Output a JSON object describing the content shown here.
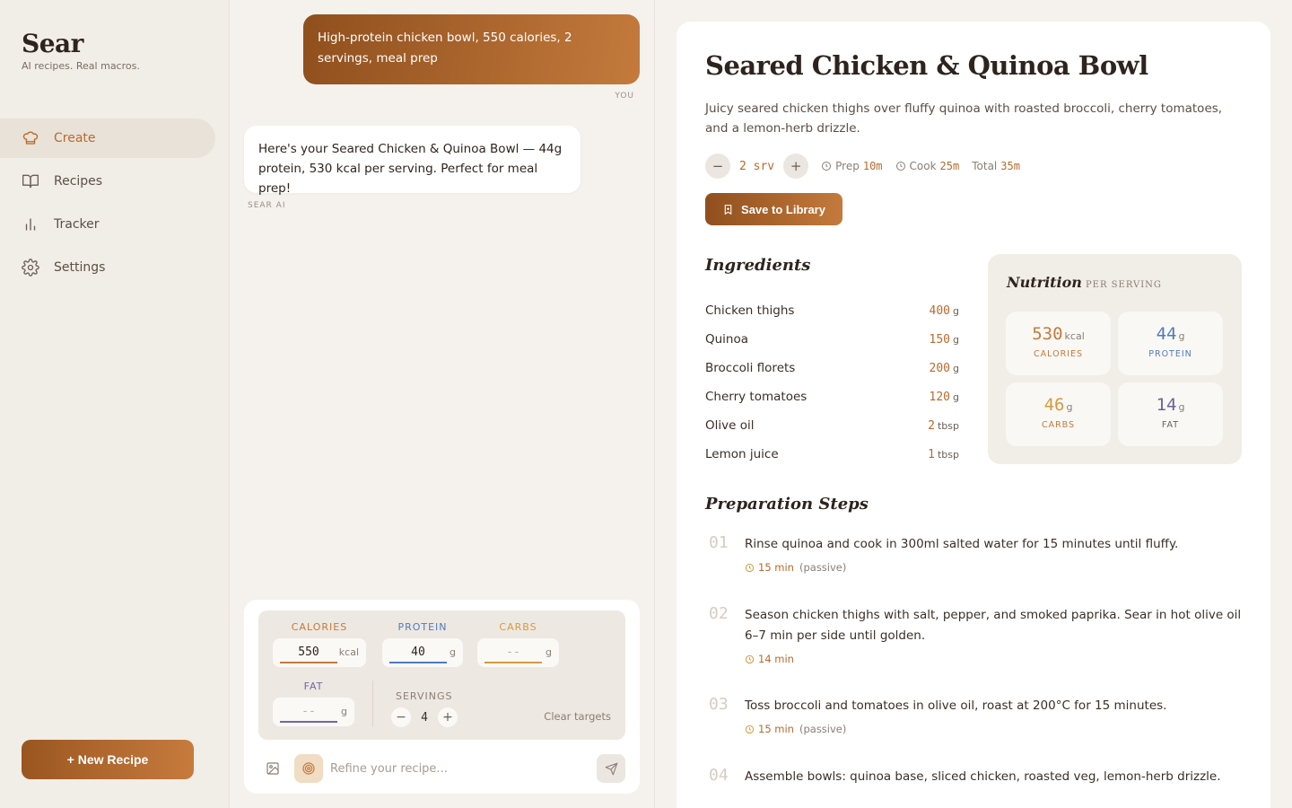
{
  "brand": {
    "name": "Sear",
    "tagline": "AI recipes. Real macros."
  },
  "nav": [
    {
      "label": "Create",
      "icon": "chef-hat-icon",
      "active": true
    },
    {
      "label": "Recipes",
      "icon": "book-icon",
      "active": false
    },
    {
      "label": "Tracker",
      "icon": "bar-chart-icon",
      "active": false
    },
    {
      "label": "Settings",
      "icon": "gear-icon",
      "active": false
    }
  ],
  "new_recipe_label": "+ New Recipe",
  "chat": {
    "user_message": "High-protein chicken bowl, 550 calories, 2 servings, meal prep",
    "user_label": "YOU",
    "ai_message": "Here's your Seared Chicken & Quinoa Bowl — 44g protein, 530 kcal per serving. Perfect for meal prep!",
    "ai_label": "SEAR AI"
  },
  "targets": {
    "calories": {
      "label": "CALORIES",
      "value": "550",
      "unit": "kcal",
      "color": "#c47a3c"
    },
    "protein": {
      "label": "PROTEIN",
      "value": "40",
      "unit": "g",
      "color": "#4f7bbf"
    },
    "carbs": {
      "label": "CARBS",
      "value": "--",
      "unit": "g",
      "color": "#d79a3e"
    },
    "fat": {
      "label": "FAT",
      "value": "--",
      "unit": "g",
      "color": "#7266a8"
    },
    "servings_label": "SERVINGS",
    "servings_value": "4",
    "clear_label": "Clear targets"
  },
  "composer": {
    "placeholder": "Refine your recipe..."
  },
  "recipe": {
    "title": "Seared Chicken & Quinoa Bowl",
    "description": "Juicy seared chicken thighs over fluffy quinoa with roasted broccoli, cherry tomatoes, and a lemon-herb drizzle.",
    "servings": "2 srv",
    "prep_label": "Prep",
    "prep_value": "10m",
    "cook_label": "Cook",
    "cook_value": "25m",
    "total_label": "Total",
    "total_value": "35m",
    "save_label": "Save to Library",
    "ingredients_heading": "Ingredients",
    "ingredients": [
      {
        "name": "Chicken thighs",
        "qty": "400",
        "unit": "g"
      },
      {
        "name": "Quinoa",
        "qty": "150",
        "unit": "g"
      },
      {
        "name": "Broccoli florets",
        "qty": "200",
        "unit": "g"
      },
      {
        "name": "Cherry tomatoes",
        "qty": "120",
        "unit": "g"
      },
      {
        "name": "Olive oil",
        "qty": "2",
        "unit": "tbsp"
      },
      {
        "name": "Lemon juice",
        "qty": "1",
        "unit": "tbsp"
      }
    ],
    "nutrition": {
      "heading": "Nutrition",
      "sub": "PER SERVING",
      "calories": {
        "value": "530",
        "unit": "kcal",
        "label": "CALORIES",
        "color": "#c47a3c"
      },
      "protein": {
        "value": "44",
        "unit": "g",
        "label": "PROTEIN",
        "color": "#4f7bbf"
      },
      "carbs": {
        "value": "46",
        "unit": "g",
        "label": "CARBS",
        "color": "#d79a3e"
      },
      "fat": {
        "value": "14",
        "unit": "g",
        "label": "FAT",
        "color": "#6a6494"
      }
    },
    "steps_heading": "Preparation Steps",
    "steps": [
      {
        "num": "01",
        "text": "Rinse quinoa and cook in 300ml salted water for 15 minutes until fluffy.",
        "time": "15 min",
        "note": "(passive)"
      },
      {
        "num": "02",
        "text": "Season chicken thighs with salt, pepper, and smoked paprika. Sear in hot olive oil 6–7 min per side until golden.",
        "time": "14 min",
        "note": ""
      },
      {
        "num": "03",
        "text": "Toss broccoli and tomatoes in olive oil, roast at 200°C for 15 minutes.",
        "time": "15 min",
        "note": "(passive)"
      },
      {
        "num": "04",
        "text": "Assemble bowls: quinoa base, sliced chicken, roasted veg, lemon-herb drizzle.",
        "time": "",
        "note": ""
      }
    ]
  }
}
